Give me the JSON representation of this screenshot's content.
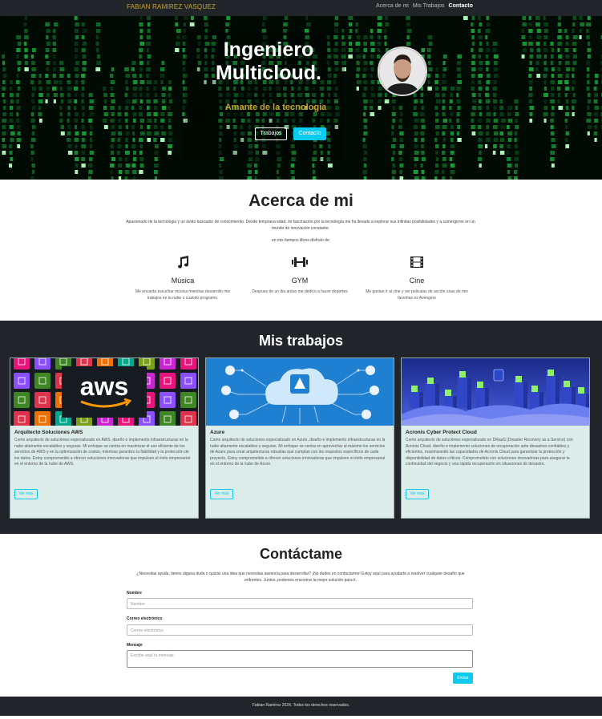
{
  "navbar": {
    "brand": "FABIAN RAMIREZ VASQUEZ",
    "links": [
      {
        "label": "Acerca de mi"
      },
      {
        "label": "Mis Trabajos"
      },
      {
        "label": "Contacto"
      }
    ]
  },
  "hero": {
    "title": "Ingeniero Multicloud.",
    "subtitle": "Amante de la tecnologia",
    "buttons": {
      "works": "Trabajos",
      "contact": "Contacto"
    }
  },
  "about": {
    "title": "Acerca de mi",
    "text": "Apasionado de la tecnologia y un ávido buscador de conocimiento. Desde temprana edad, mi fascinación por la tecnología me ha llevado a explorar sus infinitas posibilidades y a sumergirme en un mundo de innovación constante.",
    "free_time": "en mis tiempos libres disfruto de:",
    "hobbies": [
      {
        "icon": "music-note-icon",
        "title": "Música",
        "desc": "Me encanta escuchar música mientras desarrollo mis trabajos en la nube o cuando programo."
      },
      {
        "icon": "dumbbell-icon",
        "title": "GYM",
        "desc": "Despues de un dia arduo me dedico a hacer deportes"
      },
      {
        "icon": "film-icon",
        "title": "Cine",
        "desc": "Me gustan ir al cine y ver peliculas de acción unas de mis favoritas es Avengers"
      }
    ]
  },
  "works": {
    "title": "Mis trabajos",
    "cards": [
      {
        "title": "Arquitecto Soluciones AWS",
        "text": "Como arquitecto de soluciones especializado en AWS, diseño e implemento infraestructuras en la nube altamente escalables y seguras. Mi enfoque se centra en maximizar el uso eficiente de los servicios de AWS y en la optimización de costos, mientras garantizo la fiabilidad y la protección de los datos. Estoy comprometido a ofrecer soluciones innovadoras que impulsen el éxito empresarial en el entorno de la nube de AWS.",
        "button": "Ver más",
        "logo_text": "aws"
      },
      {
        "title": "Azure",
        "text": "Como arquitecto de soluciones especializado en Azure, diseño e implemento infraestructuras en la nube altamente escalables y seguras. Mi enfoque se centra en aprovechar al máximo los servicios de Azure para crear arquitecturas robustas que cumplan con los requisitos específicos de cada proyecto. Estoy comprometido a ofrecer soluciones innovadoras que impulsen el éxito empresarial en el entorno de la nube de Azure.",
        "button": "Ver más"
      },
      {
        "title": "Acronis Cyber Protect Cloud",
        "text": "Como arquitecto de soluciones especializado en DRaaS (Disaster Recovery as a Service) con Acronis Cloud, diseño e implemento soluciones de recuperación ante desastres confiables y eficientes, maximizando las capacidades de Acronis Cloud para garantizar la protección y disponibilidad de datos críticos. Comprometido con soluciones innovadoras para asegurar la continuidad del negocio y una rápida recuperación en situaciones de desastre.",
        "button": "Ver más"
      }
    ]
  },
  "contact": {
    "title": "Contáctame",
    "text": "¿Necesitas ayuda, tienes alguna duda o quizás una idea que necesitas asesoría para desarrollar? ¡No dudes en contactarme! Estoy aquí para ayudarte a resolver cualquier desafío que enfrentes. Juntos, podemos encontrar la mejor solución para ti.",
    "name_label": "Nombre",
    "name_placeholder": "Nombre",
    "email_label": "Correo electrónico",
    "email_placeholder": "Correo electrónico",
    "message_label": "Mensaje",
    "message_placeholder": "Escribe aquí tu mensaje",
    "send": "Enviar"
  },
  "footer": {
    "text": "Fabian Ramírez 2024. Todos los derechos reservados."
  },
  "colors": {
    "accent": "#0dcaf0",
    "brand": "#c9a227",
    "dark": "#212529",
    "card_bg": "#dbece9"
  }
}
